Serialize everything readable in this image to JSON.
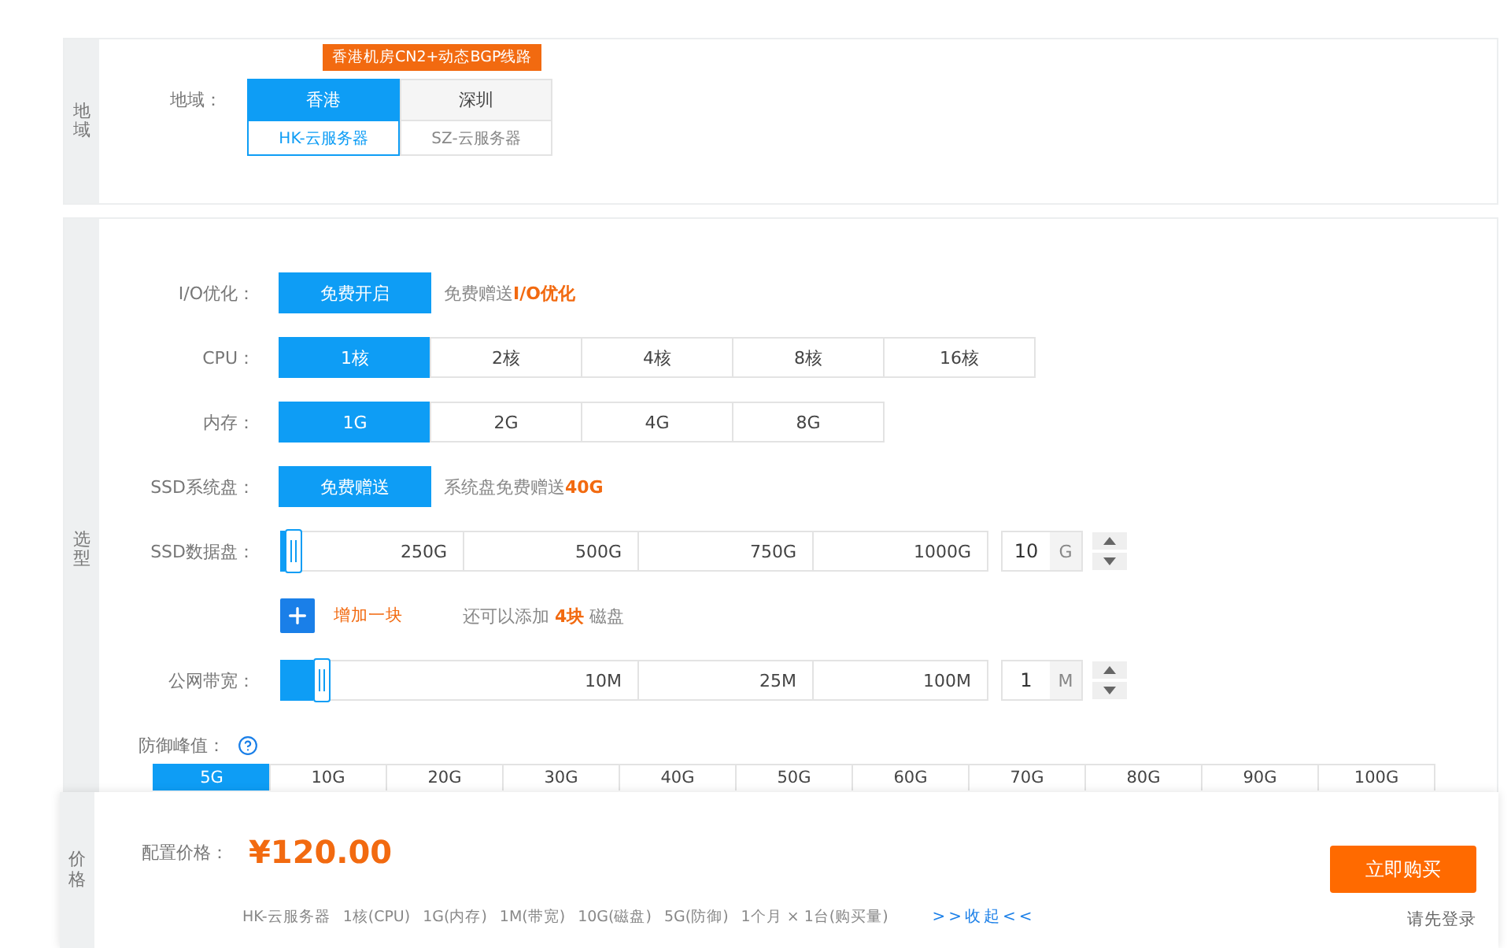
{
  "region": {
    "side_label": "地域",
    "label": "地域：",
    "tag": "香港机房CN2+动态BGP线路",
    "options": [
      {
        "name": "香港",
        "subtitle": "HK-云服务器",
        "selected": true
      },
      {
        "name": "深圳",
        "subtitle": "SZ-云服务器",
        "selected": false
      }
    ]
  },
  "config": {
    "side_label": "选型",
    "rows": [
      {
        "kind": "toggle",
        "label": "I/O优化：",
        "button": "免费开启",
        "note": "免费赠送**I/O优化**"
      },
      {
        "kind": "options",
        "label": "CPU：",
        "options": [
          {
            "label": "1核",
            "selected": true
          },
          {
            "label": "2核",
            "selected": false
          },
          {
            "label": "4核",
            "selected": false
          },
          {
            "label": "8核",
            "selected": false
          },
          {
            "label": "16核",
            "selected": false
          }
        ]
      },
      {
        "kind": "options",
        "label": "内存：",
        "options": [
          {
            "label": "1G",
            "selected": true
          },
          {
            "label": "2G",
            "selected": false
          },
          {
            "label": "4G",
            "selected": false
          },
          {
            "label": "8G",
            "selected": false
          }
        ]
      },
      {
        "kind": "toggle",
        "label": "SSD系统盘：",
        "button": "免费赠送",
        "note": "系统盘免费赠送**40G**"
      },
      {
        "kind": "slider",
        "label": "SSD数据盘：",
        "level": 0.02,
        "marks": [
          "250G",
          "500G",
          "750G",
          "1000G"
        ],
        "value": "10",
        "unit": "G"
      },
      {
        "kind": "add",
        "button": "增加一块",
        "note": "还可以添加 **4块** 磁盘"
      },
      {
        "kind": "slider",
        "label": "公网带宽：",
        "level": 0.06,
        "marks": [
          "10M",
          "25M",
          "100M"
        ],
        "value": "1",
        "unit": "M"
      },
      {
        "kind": "defense",
        "label": "防御峰值：",
        "options": [
          {
            "label": "5G",
            "selected": true
          },
          {
            "label": "10G",
            "selected": false
          },
          {
            "label": "20G",
            "selected": false
          },
          {
            "label": "30G",
            "selected": false
          },
          {
            "label": "40G",
            "selected": false
          },
          {
            "label": "50G",
            "selected": false
          },
          {
            "label": "60G",
            "selected": false
          },
          {
            "label": "70G",
            "selected": false
          },
          {
            "label": "80G",
            "selected": false
          },
          {
            "label": "90G",
            "selected": false
          },
          {
            "label": "100G",
            "selected": false
          }
        ]
      }
    ]
  },
  "price": {
    "side_label": "价格",
    "label": "配置价格：",
    "amount": "¥120.00",
    "summary": [
      "HK-云服务器",
      "1核(CPU)",
      "1G(内存)",
      "1M(带宽)",
      "10G(磁盘)",
      "5G(防御)",
      "1个月 × 1台(购买量)"
    ],
    "toggle": ">>收起<<",
    "buy": "立即购买",
    "login": "请先登录"
  }
}
